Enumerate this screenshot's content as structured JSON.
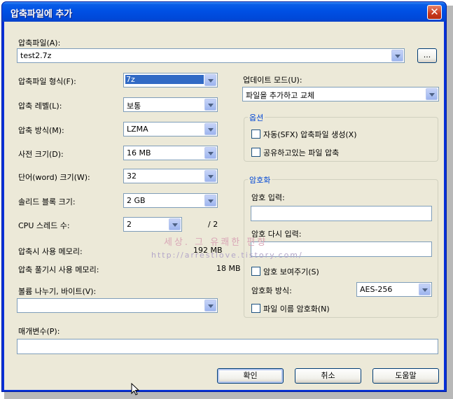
{
  "window": {
    "title": "압축파일에 추가",
    "close_glyph": "✕"
  },
  "archive": {
    "label": "압축파일(A):",
    "value": "test2.7z",
    "browse_label": "..."
  },
  "format": {
    "label": "압축파일 형식(F):",
    "value": "7z"
  },
  "level": {
    "label": "압축 레벨(L):",
    "value": "보통"
  },
  "method": {
    "label": "압축 방식(M):",
    "value": "LZMA"
  },
  "dictionary": {
    "label": "사전 크기(D):",
    "value": "16 MB"
  },
  "word_size": {
    "label": "단어(word) 크기(W):",
    "value": "32"
  },
  "solid_block": {
    "label": "솔리드 블록 크기:",
    "value": "2 GB"
  },
  "cpu_threads": {
    "label": "CPU 스레드 수:",
    "value": "2",
    "max": "/ 2"
  },
  "memory": {
    "compress_label": "압축시 사용 메모리:",
    "compress_value": "192 MB",
    "decompress_label": "압축 풀기시 사용 메모리:",
    "decompress_value": "18 MB"
  },
  "volume": {
    "label": "볼륨 나누기, 바이트(V):",
    "value": ""
  },
  "params": {
    "label": "매개변수(P):",
    "value": ""
  },
  "update_mode": {
    "label": "업데이트 모드(U):",
    "value": "파일을 추가하고 교체"
  },
  "options": {
    "group_label": "옵션",
    "sfx_label": "자동(SFX) 압축파일 생성(X)",
    "shared_label": "공유하고있는 파일 압축"
  },
  "encryption": {
    "group_label": "암호화",
    "password_label": "암호 입력:",
    "password_value": "",
    "repeat_label": "암호 다시 입력:",
    "repeat_value": "",
    "show_label": "암호 보여주기(S)",
    "method_label": "암호화 방식:",
    "method_value": "AES-256",
    "encrypt_names_label": "파일 이름 암호화(N)"
  },
  "buttons": {
    "ok": "확인",
    "cancel": "취소",
    "help": "도움말"
  },
  "watermark": {
    "line1": "세상. 그 유쾌한 편향",
    "line2": "http://arrestlove.tistory.com/"
  },
  "colors": {
    "titlebar": "#0054e3",
    "client": "#ece9d8",
    "group_label": "#0046d5",
    "selection": "#316ac5"
  },
  "icons": {
    "close": "close-icon",
    "dropdown": "chevron-down-icon",
    "cursor": "mouse-pointer-icon"
  }
}
